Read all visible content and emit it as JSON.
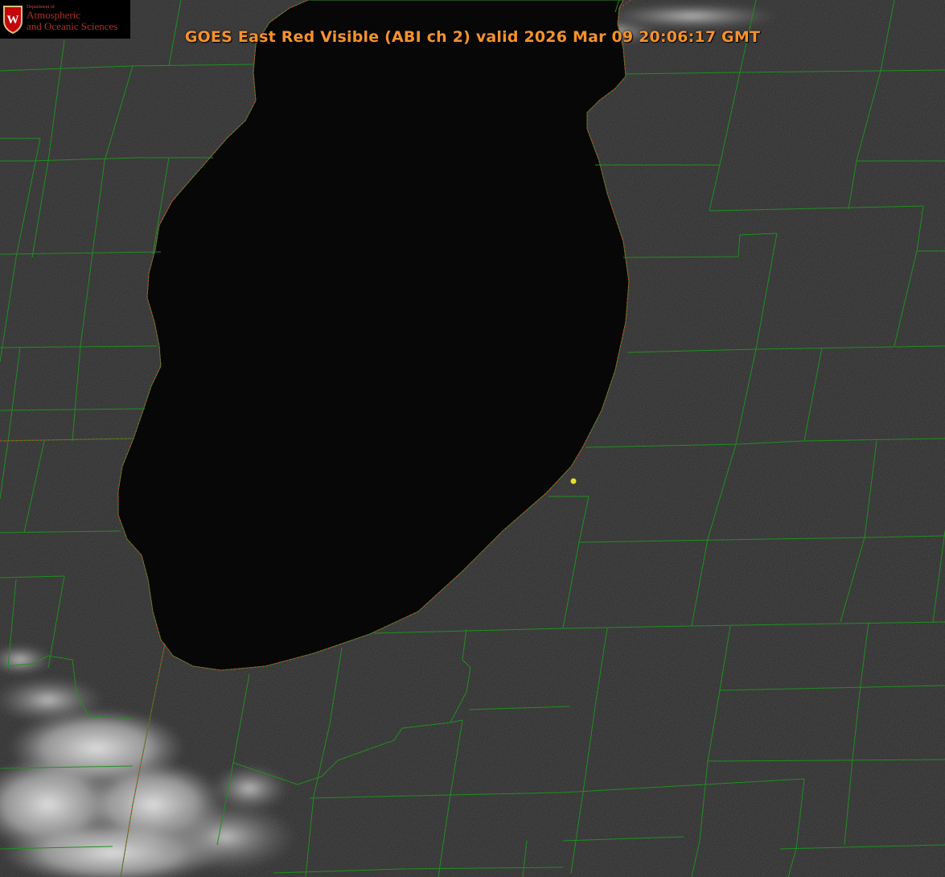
{
  "title": "GOES East Red Visible (ABI ch 2) valid 2026 Mar 09 20:06:17 GMT",
  "logo": {
    "department": "Department of",
    "line1": "Atmospheric",
    "line2": "and Oceanic Sciences",
    "shield_letter": "W"
  },
  "colors": {
    "title": "#f4922c",
    "county_lines": "#1f8f1f",
    "state_border": "#d23c2c",
    "station_marker": "#e6e024",
    "land": "#2a2a2a",
    "lake": "#070707",
    "clouds": "#cfcfcf"
  },
  "icons": {
    "logo": "uw-crest-icon",
    "station": "station-dot-icon"
  }
}
